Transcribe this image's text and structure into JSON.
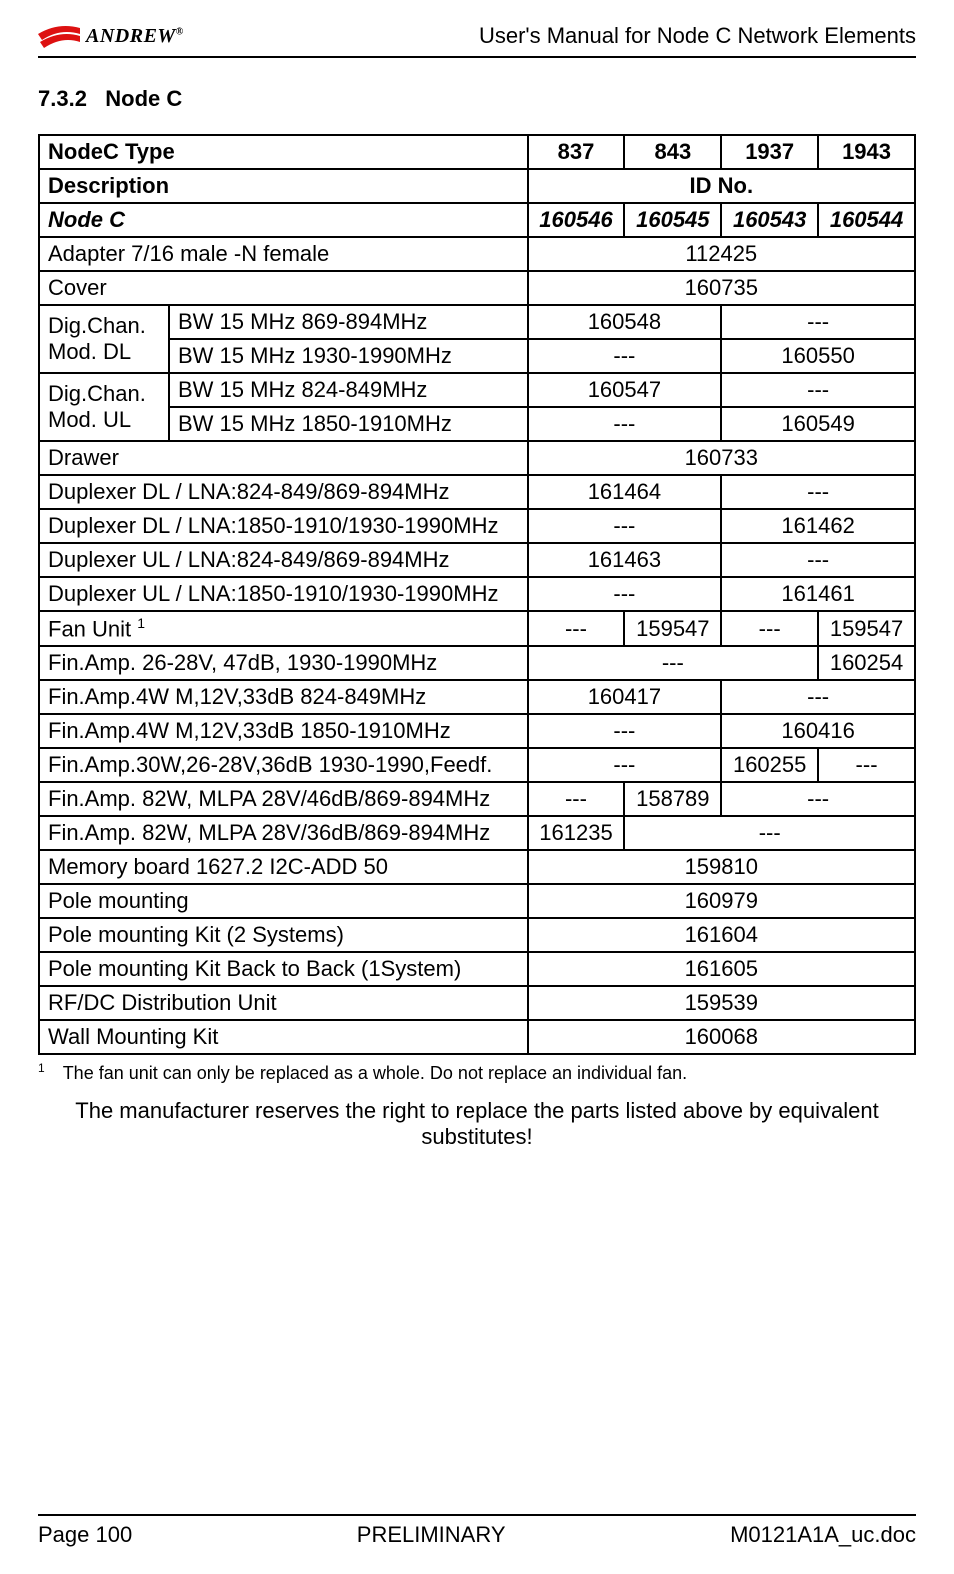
{
  "header": {
    "logo_text": "ANDREW",
    "logo_reg": "®",
    "doc_title": "User's Manual for Node C Network Elements"
  },
  "section": {
    "number": "7.3.2",
    "title": "Node C"
  },
  "table": {
    "h1": {
      "label": "NodeC Type",
      "c1": "837",
      "c2": "843",
      "c3": "1937",
      "c4": "1943"
    },
    "h2": {
      "label": "Description",
      "idno": "ID No."
    },
    "h3": {
      "label": "Node C",
      "c1": "160546",
      "c2": "160545",
      "c3": "160543",
      "c4": "160544"
    },
    "rows": {
      "adapter": {
        "label": "Adapter 7/16 male -N female",
        "val": "112425"
      },
      "cover": {
        "label": "Cover",
        "val": "160735"
      },
      "dig_dl": {
        "group": "Dig.Chan. Mod. DL",
        "r1": {
          "label": "BW 15 MHz 869-894MHz",
          "left": "160548",
          "right": "---"
        },
        "r2": {
          "label": "BW 15 MHz 1930-1990MHz",
          "left": "---",
          "right": "160550"
        }
      },
      "dig_ul": {
        "group": "Dig.Chan. Mod. UL",
        "r1": {
          "label": "BW 15 MHz 824-849MHz",
          "left": "160547",
          "right": "---"
        },
        "r2": {
          "label": "BW 15 MHz 1850-1910MHz",
          "left": "---",
          "right": "160549"
        }
      },
      "drawer": {
        "label": "Drawer",
        "val": "160733"
      },
      "dup_dl1": {
        "label": "Duplexer DL / LNA:824-849/869-894MHz",
        "left": "161464",
        "right": "---"
      },
      "dup_dl2": {
        "label": "Duplexer DL / LNA:1850-1910/1930-1990MHz",
        "left": "---",
        "right": "161462"
      },
      "dup_ul1": {
        "label": "Duplexer UL / LNA:824-849/869-894MHz",
        "left": "161463",
        "right": "---"
      },
      "dup_ul2": {
        "label": "Duplexer UL / LNA:1850-1910/1930-1990MHz",
        "left": "---",
        "right": "161461"
      },
      "fan": {
        "label": "Fan Unit ",
        "sup": "1",
        "c1": "---",
        "c2": "159547",
        "c3": "---",
        "c4": "159547"
      },
      "amp1": {
        "label": "Fin.Amp. 26-28V, 47dB, 1930-1990MHz",
        "left3": "---",
        "c4": "160254"
      },
      "amp2": {
        "label": "Fin.Amp.4W M,12V,33dB 824-849MHz",
        "left": "160417",
        "right": "---"
      },
      "amp3": {
        "label": "Fin.Amp.4W M,12V,33dB 1850-1910MHz",
        "left": "---",
        "right": "160416"
      },
      "amp4": {
        "label": "Fin.Amp.30W,26-28V,36dB 1930-1990,Feedf.",
        "left": "---",
        "c3": "160255",
        "c4": "---"
      },
      "amp5": {
        "label": "Fin.Amp. 82W, MLPA 28V/46dB/869-894MHz",
        "c1": "---",
        "c2": "158789",
        "right": "---"
      },
      "amp6": {
        "label": "Fin.Amp. 82W, MLPA 28V/36dB/869-894MHz",
        "c1": "161235",
        "right3": "---"
      },
      "memory": {
        "label": "Memory board 1627.2 I2C-ADD 50",
        "val": "159810"
      },
      "pole": {
        "label": "Pole mounting",
        "val": "160979"
      },
      "pole_kit2": {
        "label": "Pole mounting Kit (2 Systems)",
        "val": "161604"
      },
      "pole_kitb": {
        "label": "Pole mounting Kit Back to Back (1System)",
        "val": "161605"
      },
      "rfdc": {
        "label": "RF/DC Distribution Unit",
        "val": "159539"
      },
      "wall": {
        "label": "Wall Mounting Kit",
        "val": "160068"
      }
    }
  },
  "footnote": {
    "mark": "1",
    "text": "The fan unit can only be replaced as a whole. Do not replace an individual fan."
  },
  "disclaimer": "The manufacturer reserves the right to replace the parts listed above by equivalent substitutes!",
  "footer": {
    "left": "Page 100",
    "center": "PRELIMINARY",
    "right": "M0121A1A_uc.doc"
  }
}
